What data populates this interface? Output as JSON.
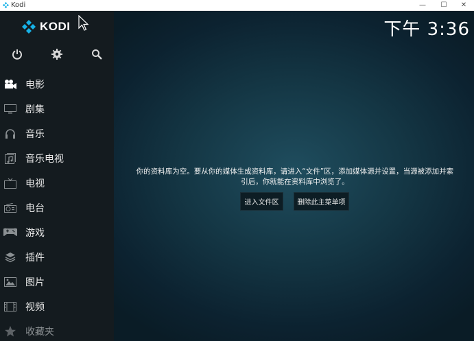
{
  "window": {
    "title": "Kodi",
    "buttons": {
      "minimize": "—",
      "maximize": "☐",
      "close": "✕"
    }
  },
  "logo": {
    "text": "KODI"
  },
  "clock": "下午 3:36",
  "top_icons": [
    {
      "name": "power-icon"
    },
    {
      "name": "settings-icon"
    },
    {
      "name": "search-icon"
    }
  ],
  "menu": {
    "items": [
      {
        "label": "电影",
        "icon": "movie-camera-icon",
        "active": true
      },
      {
        "label": "剧集",
        "icon": "tv-show-icon"
      },
      {
        "label": "音乐",
        "icon": "headphones-icon"
      },
      {
        "label": "音乐电视",
        "icon": "music-video-icon"
      },
      {
        "label": "电视",
        "icon": "tv-icon"
      },
      {
        "label": "电台",
        "icon": "radio-icon"
      },
      {
        "label": "游戏",
        "icon": "gamepad-icon"
      },
      {
        "label": "插件",
        "icon": "addons-icon"
      },
      {
        "label": "图片",
        "icon": "pictures-icon"
      },
      {
        "label": "视频",
        "icon": "videos-icon"
      },
      {
        "label": "收藏夹",
        "icon": "star-icon"
      }
    ]
  },
  "main": {
    "message_line1": "你的资料库为空。要从你的媒体生成资料库，请进入“文件”区，添加媒体源并设置，当源被添加并索",
    "message_line2": "引后，你就能在资料库中浏览了。",
    "enter_files_button": "进入文件区",
    "remove_menu_button": "删除此主菜单项"
  },
  "colors": {
    "sidebar_bg": "#141b1f",
    "accent_blue": "#17b2e7",
    "main_bg": "#143644"
  }
}
